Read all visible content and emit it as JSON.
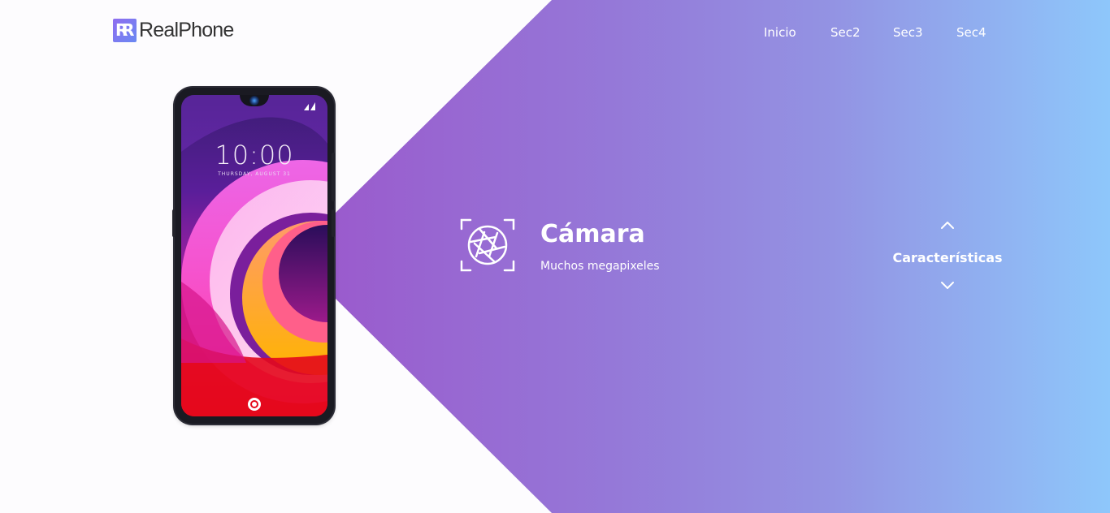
{
  "brand": {
    "logo_letters": "R",
    "name": "RealPhone"
  },
  "nav": {
    "items": [
      {
        "label": "Inicio"
      },
      {
        "label": "Sec2"
      },
      {
        "label": "Sec3"
      },
      {
        "label": "Sec4"
      }
    ]
  },
  "phone": {
    "clock": "10:00",
    "date": "THURSDAY, AUGUST 31"
  },
  "feature": {
    "icon": "camera-aperture-icon",
    "title": "Cámara",
    "subtitle": "Muchos megapixeles"
  },
  "selector": {
    "label": "Características",
    "up_icon": "chevron-up-icon",
    "down_icon": "chevron-down-icon"
  },
  "colors": {
    "gradient_start": "#9a5bcd",
    "gradient_mid": "#9393e3",
    "gradient_end": "#8ec7fb",
    "logo_text": "#333333",
    "accent_text": "#ffffff"
  }
}
